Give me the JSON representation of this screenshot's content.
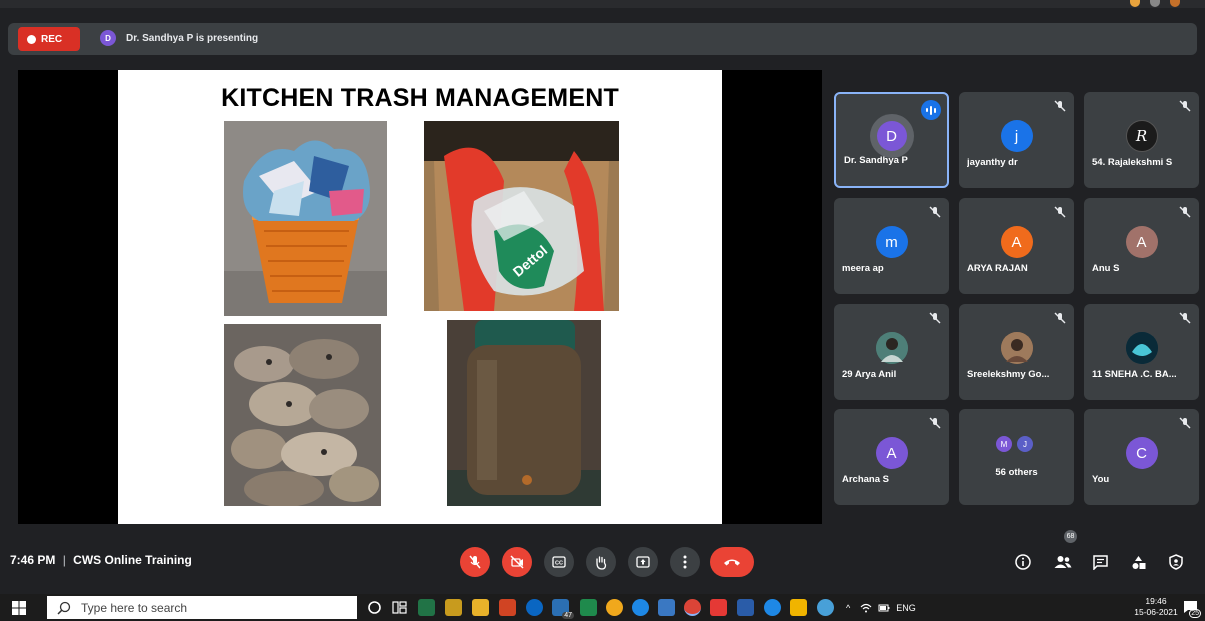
{
  "recording": {
    "label": "REC"
  },
  "presenter": {
    "initial": "D",
    "text": "Dr. Sandhya P is presenting"
  },
  "slide": {
    "title": "KITCHEN TRASH MANAGEMENT"
  },
  "participants": [
    {
      "name": "Dr. Sandhya P",
      "initial": "D",
      "color": "#7b57d6",
      "speaking": true
    },
    {
      "name": "jayanthy dr",
      "initial": "j",
      "color": "#1a73e8"
    },
    {
      "name": "54. Rajalekshmi S",
      "initial": "R",
      "color": "#1b1b1b"
    },
    {
      "name": "meera ap",
      "initial": "m",
      "color": "#1a73e8"
    },
    {
      "name": "ARYA RAJAN",
      "initial": "A",
      "color": "#f06b1c"
    },
    {
      "name": "Anu S",
      "initial": "A",
      "color": "#a1726a"
    },
    {
      "name": "29 Arya Anil",
      "initial": "",
      "color": "#3f6f6a"
    },
    {
      "name": "Sreelekshmy Go...",
      "initial": "",
      "color": "#8a5a3c"
    },
    {
      "name": "11 SNEHA .C. BA...",
      "initial": "",
      "color": "#0d3b4d"
    },
    {
      "name": "Archana S",
      "initial": "A",
      "color": "#7b57d6"
    },
    {
      "name": "56 others",
      "initial": "",
      "color": ""
    },
    {
      "name": "You",
      "initial": "C",
      "color": "#7b57d6"
    }
  ],
  "others_avatars": [
    {
      "initial": "M",
      "color": "#7b57d6"
    },
    {
      "initial": "J",
      "color": "#5b5fc7"
    }
  ],
  "meeting": {
    "time": "7:46 PM",
    "separator": "|",
    "name": "CWS Online Training"
  },
  "people_count": "68",
  "taskbar": {
    "search_placeholder": "Type here to search",
    "lang": "ENG",
    "time": "19:46",
    "date": "15-06-2021",
    "notification_count": "25",
    "badge_47": "47"
  }
}
